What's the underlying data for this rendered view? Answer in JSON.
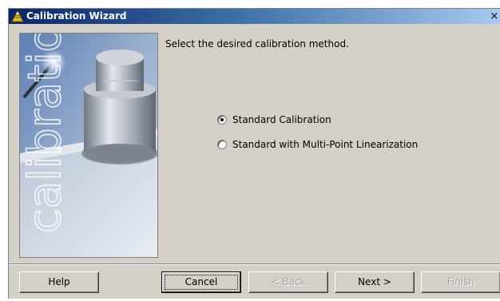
{
  "window": {
    "title": "Calibration Wizard",
    "close_glyph": "×"
  },
  "sidebar_image": {
    "watermark_text": "calibration",
    "icon": "scale-weight-image"
  },
  "main": {
    "prompt": "Select the desired calibration method.",
    "options": [
      {
        "label": "Standard Calibration",
        "selected": true
      },
      {
        "label": "Standard with Multi-Point Linearization",
        "selected": false
      }
    ]
  },
  "buttons": {
    "help": "Help",
    "cancel": "Cancel",
    "back": "< Back",
    "next": "Next >",
    "finish": "Finish"
  },
  "colors": {
    "title_start": "#0a246a",
    "title_end": "#a6caf0",
    "dialog_face": "#d4d0c8"
  }
}
